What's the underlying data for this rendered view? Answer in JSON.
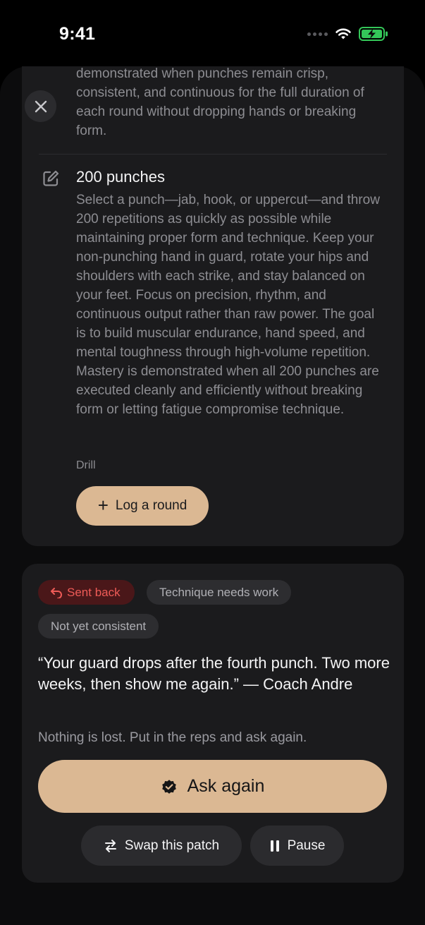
{
  "status_bar": {
    "time": "9:41"
  },
  "previous_drill": {
    "description_tail": "demonstrated when punches remain crisp, consistent, and continuous for the full duration of each round without dropping hands or breaking form."
  },
  "drill": {
    "title": "200 punches",
    "description": "Select a punch—jab, hook, or uppercut—and throw 200 repetitions as quickly as possible while maintaining proper form and technique. Keep your non-punching hand in guard, rotate your hips and shoulders with each strike, and stay balanced on your feet. Focus on precision, rhythm, and continuous output rather than raw power. The goal is to build muscular endurance, hand speed, and mental toughness through high-volume repetition. Mastery is demonstrated when all 200 punches are executed cleanly and efficiently without breaking form or letting fatigue compromise technique.",
    "type": "Drill",
    "log_label": "Log a round"
  },
  "review": {
    "chips": {
      "sent_back": "Sent back",
      "technique": "Technique needs work",
      "consistency": "Not yet consistent"
    },
    "quote": "“Your guard drops after the fourth punch. Two more weeks, then show me again.” — Coach Andre",
    "note": "Nothing is lost. Put in the reps and ask again.",
    "ask_again_label": "Ask again",
    "swap_label": "Swap this patch",
    "pause_label": "Pause"
  },
  "colors": {
    "accent": "#dbb893",
    "danger": "#ee5b57",
    "battery": "#34c759"
  }
}
